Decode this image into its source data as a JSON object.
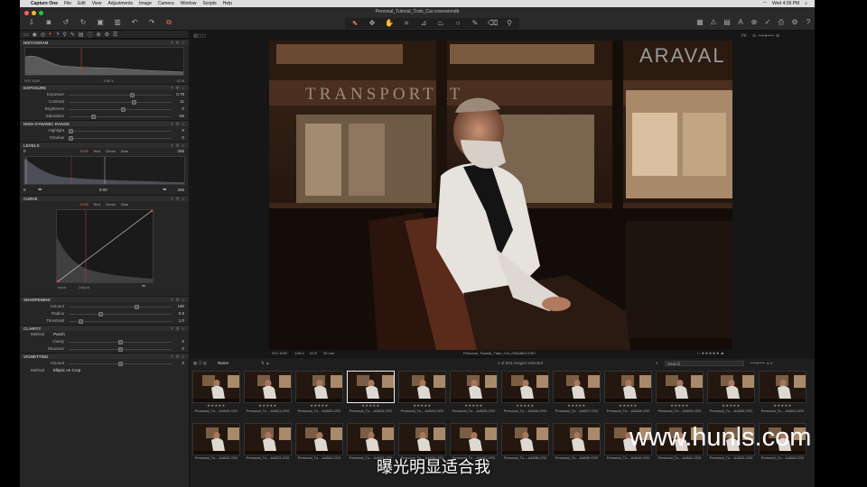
{
  "menubar": {
    "app_name": "Capture One",
    "items": [
      "File",
      "Edit",
      "View",
      "Adjustments",
      "Image",
      "Camera",
      "Window",
      "Scripts",
      "Help"
    ],
    "clock": "Wed 4:39 PM"
  },
  "window": {
    "title": "Personal_Tutorial_Train_Car.cosessiondb"
  },
  "toolbar": {
    "left_icons": [
      "import-icon",
      "capture-icon",
      "rotate-left-icon",
      "rotate-right-icon",
      "copy-icon",
      "delete-icon",
      "undo-icon",
      "redo-icon",
      "process-icon"
    ],
    "center_icons": [
      "cursor-icon",
      "pan-icon",
      "hand-icon",
      "crop-icon",
      "straighten-icon",
      "keystone-icon",
      "spot-icon",
      "brush-icon",
      "eraser-icon",
      "picker-icon"
    ],
    "right_icons": [
      "grid-icon",
      "warning-icon",
      "exposure-warning-icon",
      "text-icon",
      "loupe-icon",
      "pick-icon",
      "print-icon",
      "settings-icon",
      "help-icon"
    ]
  },
  "histogram": {
    "title": "HISTOGRAM",
    "iso": "ISO 1000",
    "shutter": "1/30 s",
    "aperture": "f/2.8"
  },
  "exposure": {
    "title": "EXPOSURE",
    "rows": [
      {
        "label": "Exposure",
        "value": "0.79",
        "level": 0.62
      },
      {
        "label": "Contrast",
        "value": "11",
        "level": 0.64
      },
      {
        "label": "Brightness",
        "value": "0",
        "level": 0.53
      },
      {
        "label": "Saturation",
        "value": "-56",
        "level": 0.23
      }
    ]
  },
  "hdr": {
    "title": "HIGH DYNAMIC RANGE",
    "rows": [
      {
        "label": "Highlight",
        "value": "0",
        "level": 0.0
      },
      {
        "label": "Shadow",
        "value": "0",
        "level": 0.0
      }
    ]
  },
  "levels": {
    "title": "LEVELS",
    "channels": [
      "RGB",
      "Red",
      "Green",
      "Blue"
    ],
    "low": "0",
    "high": "255",
    "in_low": "0",
    "mid": "0.00",
    "in_high": "255"
  },
  "curves": {
    "title": "CURVE",
    "channels": [
      "RGB",
      "Red",
      "Green",
      "Blue"
    ],
    "input_label": "Input",
    "output_label": "Output"
  },
  "sharpening": {
    "title": "SHARPENING",
    "rows": [
      {
        "label": "Amount",
        "value": "180",
        "level": 0.66
      },
      {
        "label": "Radius",
        "value": "0.8",
        "level": 0.3
      },
      {
        "label": "Threshold",
        "value": "1.0",
        "level": 0.1
      }
    ]
  },
  "clarity": {
    "title": "CLARITY",
    "method_label": "Method",
    "method_value": "Punch",
    "rows": [
      {
        "label": "Clarity",
        "value": "0",
        "level": 0.5
      },
      {
        "label": "Structure",
        "value": "0",
        "level": 0.5
      }
    ]
  },
  "vignetting": {
    "title": "VIGNETTING",
    "rows": [
      {
        "label": "Amount",
        "value": "0",
        "level": 0.5
      }
    ],
    "method_label": "Method",
    "method_value": "Elliptic on Crop"
  },
  "viewer": {
    "zoom": "Fit",
    "iso": "ISO 1000",
    "shutter": "1/30 s",
    "aperture": "f/2.8",
    "focal": "35 mm",
    "filename": "Personal_Tutorial_Train_Car_GBA4823.CR2",
    "sign_text": "TRANSPORTAT",
    "sign_text_2": "ARAVAL"
  },
  "browser": {
    "sort_label": "Name",
    "count_text": "1 of 604 images selected",
    "search_placeholder": "Search",
    "row1": [
      {
        "name": "Personal_Tu....A4820.CR2",
        "stars": "★★★★★"
      },
      {
        "name": "Personal_Tu....A4821.CR2",
        "stars": "★★★★★"
      },
      {
        "name": "Personal_Tu....A4822.CR2",
        "stars": "★★★★★"
      },
      {
        "name": "Personal_Tu....A4823.CR2",
        "stars": "★★★★★"
      },
      {
        "name": "Personal_Tu....A4824.CR2",
        "stars": "★★★★★"
      },
      {
        "name": "Personal_Tu....A4825.CR2",
        "stars": "★★★★★"
      },
      {
        "name": "Personal_Tu....A4826.CR2",
        "stars": "★★★★★"
      },
      {
        "name": "Personal_Tu....A4827.CR2",
        "stars": "★★★★★"
      },
      {
        "name": "Personal_Tu....A4828.CR2",
        "stars": "★★★★★"
      },
      {
        "name": "Personal_Tu....A4829.CR2",
        "stars": "★★★★★"
      },
      {
        "name": "Personal_Tu....A4830.CR2",
        "stars": "★★★★★"
      },
      {
        "name": "Personal_Tu....A4831.CR2",
        "stars": "★★★★★"
      }
    ],
    "row2": [
      {
        "name": "Personal_Tu....A4832.CR2"
      },
      {
        "name": "Personal_Tu....A4833.CR2"
      },
      {
        "name": "Personal_Tu....A4834.CR2"
      },
      {
        "name": "Personal_Tu....A4835.CR2"
      },
      {
        "name": "Personal_Tu....A4836.CR2"
      },
      {
        "name": "Personal_Tu....A4837.CR2"
      },
      {
        "name": "Personal_Tu....A4838.CR2"
      },
      {
        "name": "Personal_Tu....A4839.CR2"
      },
      {
        "name": "Personal_Tu....A4840.CR2"
      },
      {
        "name": "Personal_Tu....A4841.CR2"
      },
      {
        "name": "Personal_Tu....A4842.CR2"
      },
      {
        "name": "Personal_Tu....A4843.CR2"
      }
    ]
  },
  "overlay": {
    "watermark": "www.hunls.com",
    "subtitle": "曝光明显适合我"
  },
  "colors": {
    "accent": "#e7703a",
    "panel": "#262626",
    "viewer_bg": "#161616"
  }
}
